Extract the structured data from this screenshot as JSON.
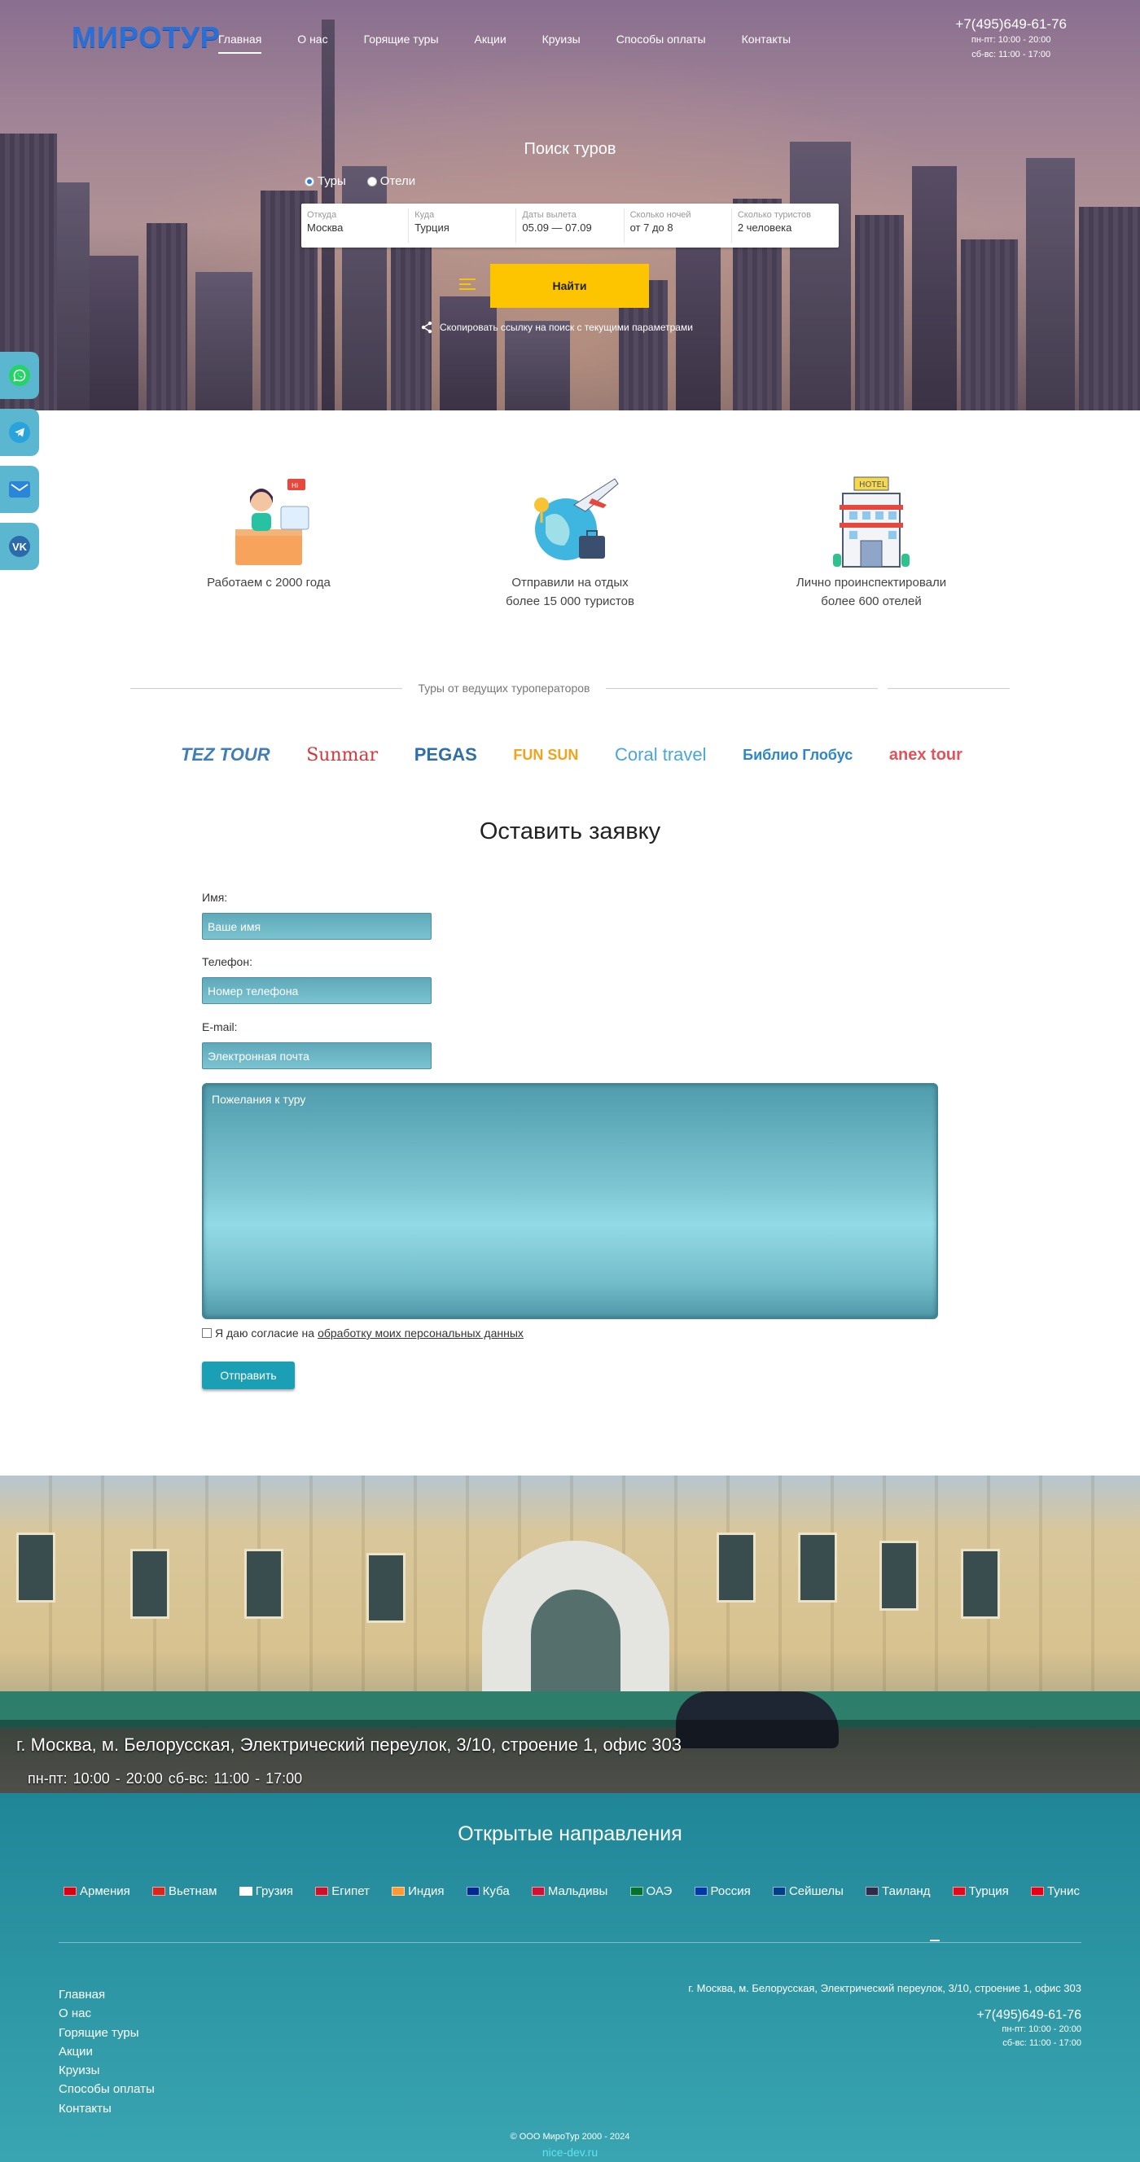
{
  "header": {
    "logo_text": "МИРОТУР",
    "nav": [
      "Главная",
      "О нас",
      "Горящие туры",
      "Акции",
      "Круизы",
      "Способы оплаты",
      "Контакты"
    ],
    "active_nav": "Главная",
    "phone": "+7(495)649-61-76",
    "hours_weekday": "пн-пт: 10:00 - 20:00",
    "hours_weekend": "сб-вс: 11:00 - 17:00"
  },
  "search": {
    "title": "Поиск туров",
    "options": [
      "Туры",
      "Отели"
    ],
    "selected": "Туры",
    "fields": [
      {
        "label": "Откуда",
        "value": "Москва"
      },
      {
        "label": "Куда",
        "value": "Турция"
      },
      {
        "label": "Даты вылета",
        "value": "05.09 — 07.09"
      },
      {
        "label": "Сколько ночей",
        "value": "от 7 до 8"
      },
      {
        "label": "Сколько туристов",
        "value": "2 человека"
      }
    ],
    "find_button": "Найти",
    "share_text": "Скопировать ссылку на поиск с текущими параметрами"
  },
  "social": [
    "whatsapp-icon",
    "telegram-icon",
    "email-icon",
    "vk-icon"
  ],
  "features": [
    {
      "line1": "Работаем с 2000 года",
      "line2": ""
    },
    {
      "line1": "Отправили на отдых",
      "line2": "более 15 000 туристов"
    },
    {
      "line1": "Лично проинспектировали",
      "line2": "более 600 отелей"
    }
  ],
  "operators": {
    "title": "Туры от ведущих туроператоров",
    "logos": [
      "TEZ TOUR",
      "Sunmar",
      "PEGAS",
      "FUN SUN",
      "Coral travel",
      "Библио Глобус",
      "anex tour"
    ]
  },
  "form": {
    "title": "Оставить заявку",
    "name_label": "Имя:",
    "name_placeholder": "Ваше имя",
    "phone_label": "Телефон:",
    "phone_placeholder": "Номер телефона",
    "email_label": "E-mail:",
    "email_placeholder": "Электронная почта",
    "wishes_placeholder": "Пожелания к туру",
    "consent_prefix": "Я даю согласие на",
    "consent_link": "обработку моих персональных данных",
    "submit": "Отправить"
  },
  "office": {
    "address": "г. Москва, м. Белорусская, Электрический переулок, 3/10, строение 1, офис 303",
    "hours": "пн-пт: 10:00 - 20:00    сб-вс: 11:00 - 17:00"
  },
  "footer": {
    "destinations_title": "Открытые направления",
    "destinations": [
      {
        "name": "Армения",
        "flag": "#d90012"
      },
      {
        "name": "Вьетнам",
        "flag": "#da251d"
      },
      {
        "name": "Грузия",
        "flag": "#ffffff"
      },
      {
        "name": "Египет",
        "flag": "#ce1126"
      },
      {
        "name": "Индия",
        "flag": "#ff9933"
      },
      {
        "name": "Куба",
        "flag": "#002a8f"
      },
      {
        "name": "Мальдивы",
        "flag": "#d21034"
      },
      {
        "name": "ОАЭ",
        "flag": "#00732f"
      },
      {
        "name": "Россия",
        "flag": "#0039a6"
      },
      {
        "name": "Сейшелы",
        "flag": "#003f87"
      },
      {
        "name": "Таиланд",
        "flag": "#2d2a4a"
      },
      {
        "name": "Турция",
        "flag": "#e30a17"
      },
      {
        "name": "Тунис",
        "flag": "#e70013"
      }
    ],
    "nav": [
      "Главная",
      "О нас",
      "Горящие туры",
      "Акции",
      "Круизы",
      "Способы оплаты",
      "Контакты"
    ],
    "address": "г. Москва, м. Белорусская, Электрический переулок, 3/10, строение 1, офис 303",
    "phone": "+7(495)649-61-76",
    "hours_weekday": "пн-пт: 10:00 - 20:00",
    "hours_weekend": "сб-вс: 11:00 - 17:00",
    "copyright": "© ООО МироТур 2000 - 2024",
    "developer": "nice-dev.ru"
  }
}
